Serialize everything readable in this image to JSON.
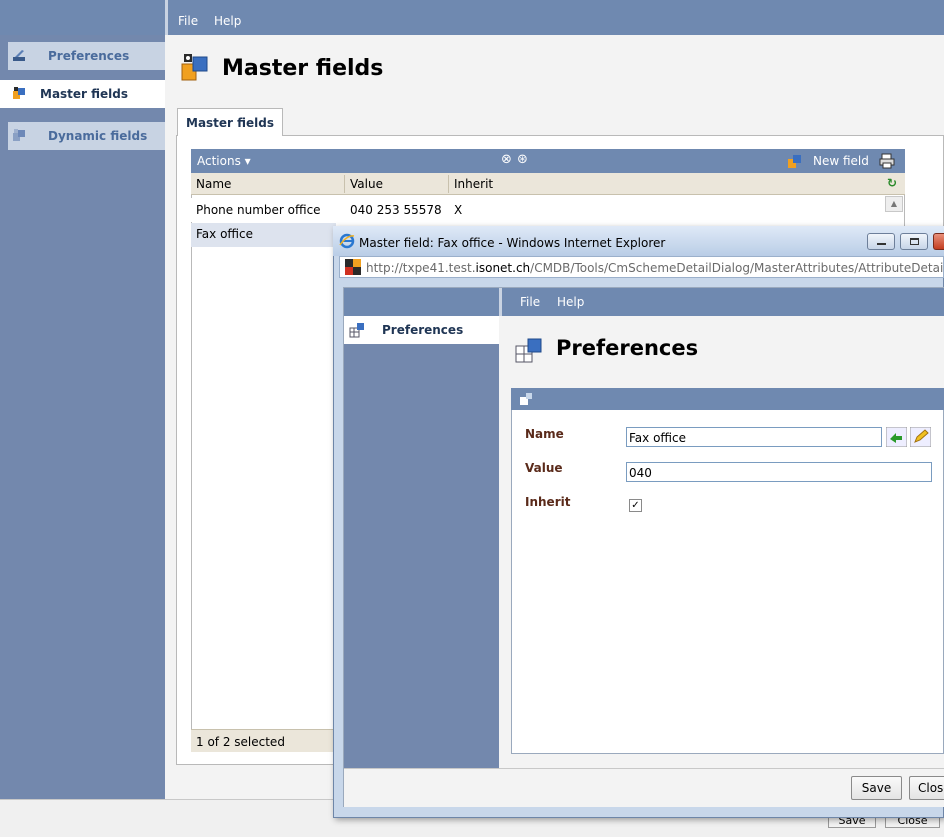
{
  "app": {
    "menu": {
      "file": "File",
      "help": "Help"
    },
    "sidebar": {
      "items": [
        {
          "label": "Preferences",
          "icon": "preferences-icon"
        },
        {
          "label": "Master fields",
          "icon": "master-fields-icon"
        },
        {
          "label": "Dynamic fields",
          "icon": "dynamic-fields-icon"
        }
      ]
    },
    "page_title": "Master fields",
    "tab_label": "Master fields",
    "grid": {
      "actions_label": "Actions ▾",
      "new_field_label": "New field",
      "columns": [
        "Name",
        "Value",
        "Inherit"
      ],
      "rows": [
        {
          "name": "Phone number office",
          "value": "040 253 55578",
          "inherit": "X"
        },
        {
          "name": "Fax office",
          "value": "",
          "inherit": ""
        }
      ],
      "footer": "1 of 2 selected"
    },
    "buttons": {
      "save": "Save",
      "close": "Close"
    }
  },
  "dialog": {
    "window_title": "Master field: Fax office - Windows Internet Explorer",
    "url_prefix": "http://txpe41.test.",
    "url_domain": "isonet.ch",
    "url_path": "/CMDB/Tools/CmSchemeDetailDialog/MasterAttributes/AttributeDetailDialog",
    "menu": {
      "file": "File",
      "help": "Help"
    },
    "sidebar_item": "Preferences",
    "page_title": "Preferences",
    "form": {
      "name_label": "Name",
      "name_value": "Fax office",
      "value_label": "Value",
      "value_value": "040",
      "inherit_label": "Inherit",
      "inherit_checked": true,
      "inherit_mark": "✓"
    },
    "buttons": {
      "save": "Save",
      "close": "Close"
    }
  },
  "colors": {
    "bar_blue": "#6f89b0",
    "sidebar_blue": "#7388ad",
    "label_brown": "#5a2a1a"
  }
}
